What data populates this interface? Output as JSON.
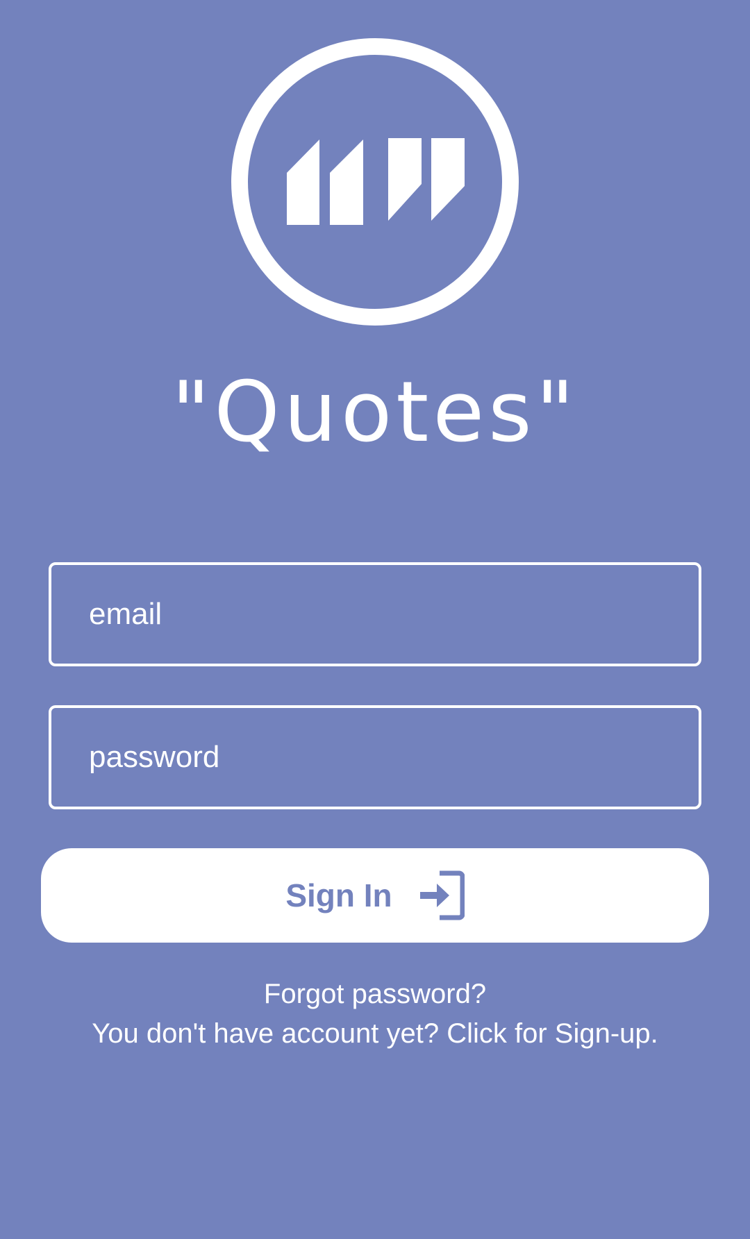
{
  "app": {
    "title": "\"Quotes\"",
    "logo_icon": "quote-marks-circle-icon"
  },
  "form": {
    "email": {
      "placeholder": "email",
      "value": ""
    },
    "password": {
      "placeholder": "password",
      "value": ""
    },
    "signin_label": "Sign In",
    "signin_icon": "sign-in-icon"
  },
  "links": {
    "forgot": "Forgot password?",
    "signup": "You don't have account yet? Click for Sign-up."
  },
  "colors": {
    "background": "#7382bd",
    "foreground": "#ffffff"
  }
}
